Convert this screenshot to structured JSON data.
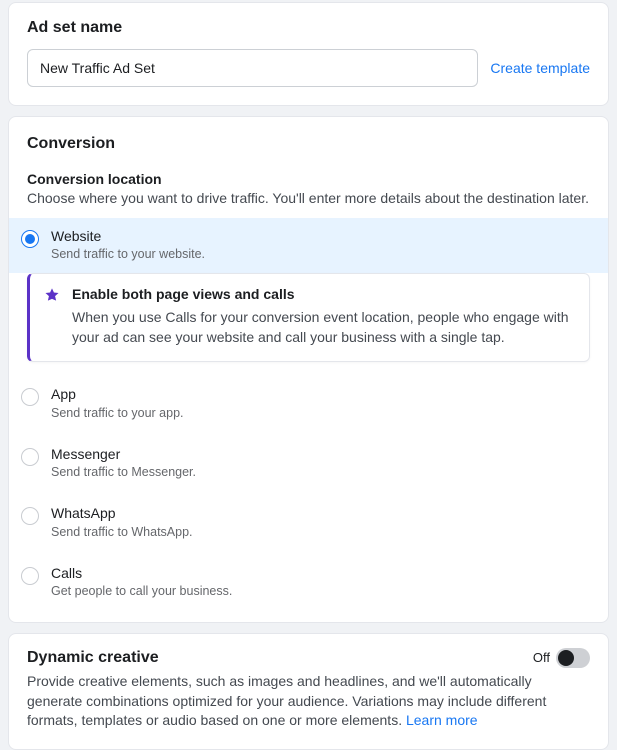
{
  "adSetName": {
    "title": "Ad set name",
    "value": "New Traffic Ad Set",
    "createTemplateLabel": "Create template"
  },
  "conversion": {
    "title": "Conversion",
    "locationTitle": "Conversion location",
    "locationDesc": "Choose where you want to drive traffic. You'll enter more details about the destination later.",
    "options": [
      {
        "title": "Website",
        "desc": "Send traffic to your website.",
        "selected": true
      },
      {
        "title": "App",
        "desc": "Send traffic to your app.",
        "selected": false
      },
      {
        "title": "Messenger",
        "desc": "Send traffic to Messenger.",
        "selected": false
      },
      {
        "title": "WhatsApp",
        "desc": "Send traffic to WhatsApp.",
        "selected": false
      },
      {
        "title": "Calls",
        "desc": "Get people to call your business.",
        "selected": false
      }
    ],
    "callout": {
      "title": "Enable both page views and calls",
      "desc": "When you use Calls for your conversion event location, people who engage with your ad can see your website and call your business with a single tap."
    }
  },
  "dynamicCreative": {
    "title": "Dynamic creative",
    "state": "Off",
    "descPrefix": "Provide creative elements, such as images and headlines, and we'll automatically generate combinations optimized for your audience. Variations may include different formats, templates or audio based on one or more elements. ",
    "learnMore": "Learn more"
  }
}
